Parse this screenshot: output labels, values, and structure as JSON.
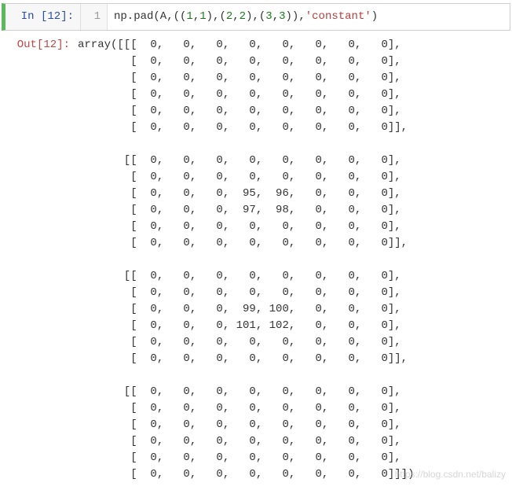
{
  "input": {
    "prompt_label": "In ",
    "execution_count": 12,
    "line_number": "1",
    "code_parts": {
      "p1": "np.pad(A,((",
      "n1": "1",
      "c1": ",",
      "n2": "1",
      "p2": "),(",
      "n3": "2",
      "c2": ",",
      "n4": "2",
      "p3": "),(",
      "n5": "3",
      "c3": ",",
      "n6": "3",
      "p4": ")),",
      "str_open": "'",
      "str_body": "constant",
      "str_close": "'",
      "p5": ")"
    }
  },
  "output": {
    "prompt_label": "Out",
    "execution_count": 12,
    "lines": [
      "array([[[  0,   0,   0,   0,   0,   0,   0,   0],",
      "        [  0,   0,   0,   0,   0,   0,   0,   0],",
      "        [  0,   0,   0,   0,   0,   0,   0,   0],",
      "        [  0,   0,   0,   0,   0,   0,   0,   0],",
      "        [  0,   0,   0,   0,   0,   0,   0,   0],",
      "        [  0,   0,   0,   0,   0,   0,   0,   0]],",
      "",
      "       [[  0,   0,   0,   0,   0,   0,   0,   0],",
      "        [  0,   0,   0,   0,   0,   0,   0,   0],",
      "        [  0,   0,   0,  95,  96,   0,   0,   0],",
      "        [  0,   0,   0,  97,  98,   0,   0,   0],",
      "        [  0,   0,   0,   0,   0,   0,   0,   0],",
      "        [  0,   0,   0,   0,   0,   0,   0,   0]],",
      "",
      "       [[  0,   0,   0,   0,   0,   0,   0,   0],",
      "        [  0,   0,   0,   0,   0,   0,   0,   0],",
      "        [  0,   0,   0,  99, 100,   0,   0,   0],",
      "        [  0,   0,   0, 101, 102,   0,   0,   0],",
      "        [  0,   0,   0,   0,   0,   0,   0,   0],",
      "        [  0,   0,   0,   0,   0,   0,   0,   0]],",
      "",
      "       [[  0,   0,   0,   0,   0,   0,   0,   0],",
      "        [  0,   0,   0,   0,   0,   0,   0,   0],",
      "        [  0,   0,   0,   0,   0,   0,   0,   0],",
      "        [  0,   0,   0,   0,   0,   0,   0,   0],",
      "        [  0,   0,   0,   0,   0,   0,   0,   0],",
      "        [  0,   0,   0,   0,   0,   0,   0,   0]]])"
    ]
  },
  "watermark": "https://blog.csdn.net/balizy"
}
